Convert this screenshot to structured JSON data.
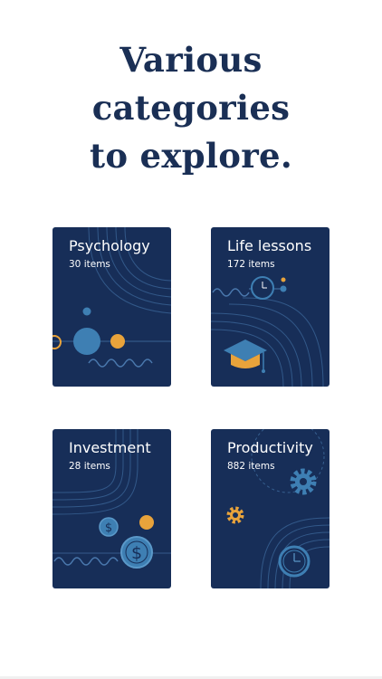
{
  "headline": {
    "line1": "Various",
    "line2": "categories",
    "line3": "to explore."
  },
  "categories": [
    {
      "title": "Psychology",
      "count": "30 items",
      "icon": "psychology-pattern-icon"
    },
    {
      "title": "Life lessons",
      "count": "172 items",
      "icon": "graduation-cap-icon"
    },
    {
      "title": "Investment",
      "count": "28 items",
      "icon": "dollar-coin-icon"
    },
    {
      "title": "Productivity",
      "count": "882 items",
      "icon": "gear-icon"
    }
  ],
  "colors": {
    "card_bg": "#172e58",
    "headline": "#1a2f55",
    "accent_orange": "#e8a33b",
    "accent_blue": "#3e7fb3",
    "line_blue": "#4a78ad"
  }
}
